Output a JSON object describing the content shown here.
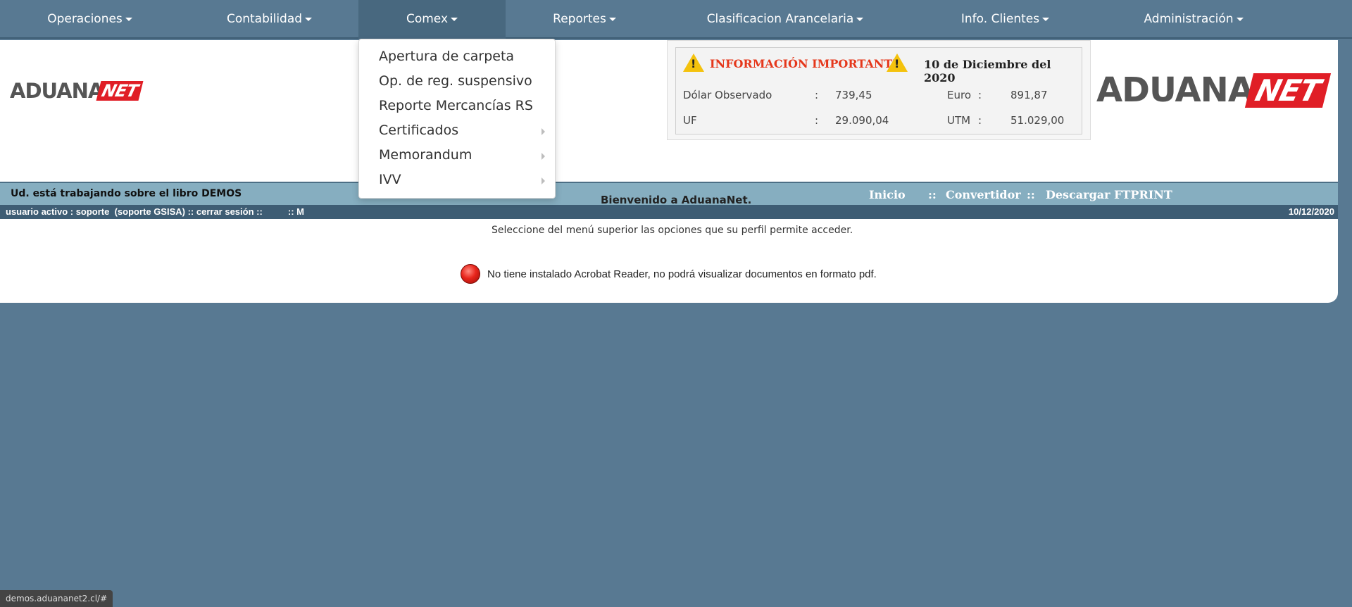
{
  "nav": {
    "items": [
      {
        "label": "Operaciones"
      },
      {
        "label": "Contabilidad"
      },
      {
        "label": "Comex"
      },
      {
        "label": "Reportes"
      },
      {
        "label": "Clasificacion Arancelaria"
      },
      {
        "label": "Info. Clientes"
      },
      {
        "label": "Administración"
      }
    ],
    "active": "Comex"
  },
  "logo": {
    "part1": "ADUANA",
    "part2": "NET"
  },
  "info": {
    "title": "INFORMACIÓN IMPORTANTE",
    "date": "10 de Diciembre del 2020",
    "rates": [
      {
        "label": "Dólar Observado",
        "sep": ":",
        "value": "739,45"
      },
      {
        "label": "Euro",
        "sep": ":",
        "value": "891,87"
      },
      {
        "label": "UF",
        "sep": ":",
        "value": "29.090,04"
      },
      {
        "label": "UTM",
        "sep": ":",
        "value": "51.029,00"
      }
    ]
  },
  "bar": {
    "libro": "Ud. está trabajando sobre el libro DEMOS",
    "links": [
      "Inicio",
      "::",
      "Convertidor",
      "::",
      "Descargar FTPRINT"
    ],
    "user": "usuario activo : soporte  (soporte GSISA) :: cerrar sesión ::          :: M",
    "date": "10/12/2020"
  },
  "main": {
    "welcome": "Bienvenido a AduanaNet.",
    "select": "Seleccione del menú superior las opciones que su perfil permite acceder.",
    "acrobat": "No tiene instalado Acrobat Reader, no podrá visualizar documentos en formato pdf."
  },
  "dropdown": {
    "items": [
      {
        "label": "Apertura de carpeta"
      },
      {
        "label": "Op. de reg. suspensivo"
      },
      {
        "label": "Reporte Mercancías RS"
      },
      {
        "label": "Certificados"
      },
      {
        "label": "Memorandum"
      },
      {
        "label": "IVV"
      }
    ]
  },
  "status_url": "demos.aduananet2.cl/#",
  "colors": {
    "background": "#587992",
    "accent_red": "#e01e26",
    "warning": "#f4c20d"
  }
}
